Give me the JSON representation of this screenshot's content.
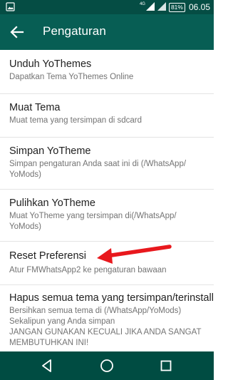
{
  "status_bar": {
    "network_label": "4G",
    "battery_level": "81%",
    "time": "06.05"
  },
  "app_bar": {
    "title": "Pengaturan"
  },
  "settings": {
    "items": [
      {
        "title": "Unduh YoThemes",
        "summary": "Dapatkan Tema YoThemes Online"
      },
      {
        "title": "Muat Tema",
        "summary": "Muat tema yang tersimpan di sdcard"
      },
      {
        "title": "Simpan YoTheme",
        "summary_lines": [
          "Simpan pengaturan Anda saat ini di (/WhatsApp/",
          "YoMods)"
        ]
      },
      {
        "title": "Pulihkan YoTheme",
        "summary_lines": [
          "Muat YoTheme yang tersimpan di(/WhatsApp/",
          "YoMods)"
        ]
      },
      {
        "title": "Reset Preferensi",
        "summary": "Atur FMWhatsApp2 ke pengaturan bawaan"
      },
      {
        "title": "Hapus semua tema yang tersimpan/terinstall",
        "summary_lines": [
          "Bersihkan semua tema di (/WhatsApp/YoMods)",
          "Sekalipun yang Anda simpan",
          "JANGAN GUNAKAN KECUALI JIKA ANDA SANGAT",
          "MEMBUTUHKAN INI!"
        ]
      }
    ]
  },
  "colors": {
    "status_bar": "#054d44",
    "app_bar": "#075e54",
    "nav_bar": "#004c42",
    "annotation_arrow": "#e8181d"
  },
  "icons": {
    "back": "arrow-left-icon",
    "nav_back": "triangle-back-icon",
    "nav_home": "circle-home-icon",
    "nav_recents": "square-recents-icon"
  }
}
